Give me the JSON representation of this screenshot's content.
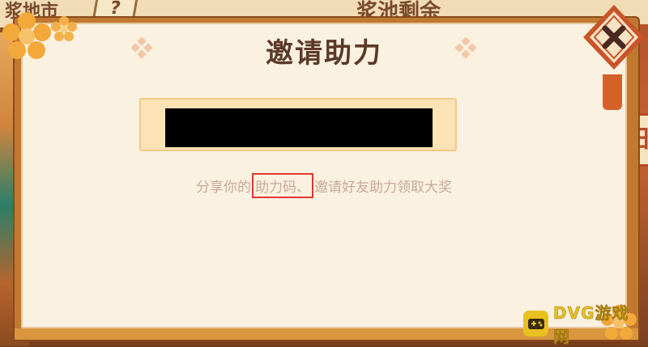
{
  "background": {
    "top_left_text": "浆地市",
    "help_label": "?",
    "top_right_text": "浆池剩余",
    "right_tab_label": "日"
  },
  "dialog": {
    "title": "邀请助力",
    "code_value": "",
    "hint": {
      "before": "分享你的",
      "highlighted": "助力码、",
      "after": "邀请好友助力领取大奖"
    },
    "close_icon": "close-icon"
  },
  "watermark": {
    "text": "DVG游戏网"
  },
  "colors": {
    "panel_bg": "#fbf1e1",
    "frame": "#c0792f",
    "title": "#5a3a28",
    "code_box": "#fbe3b6",
    "highlight_border": "#e0382e"
  }
}
